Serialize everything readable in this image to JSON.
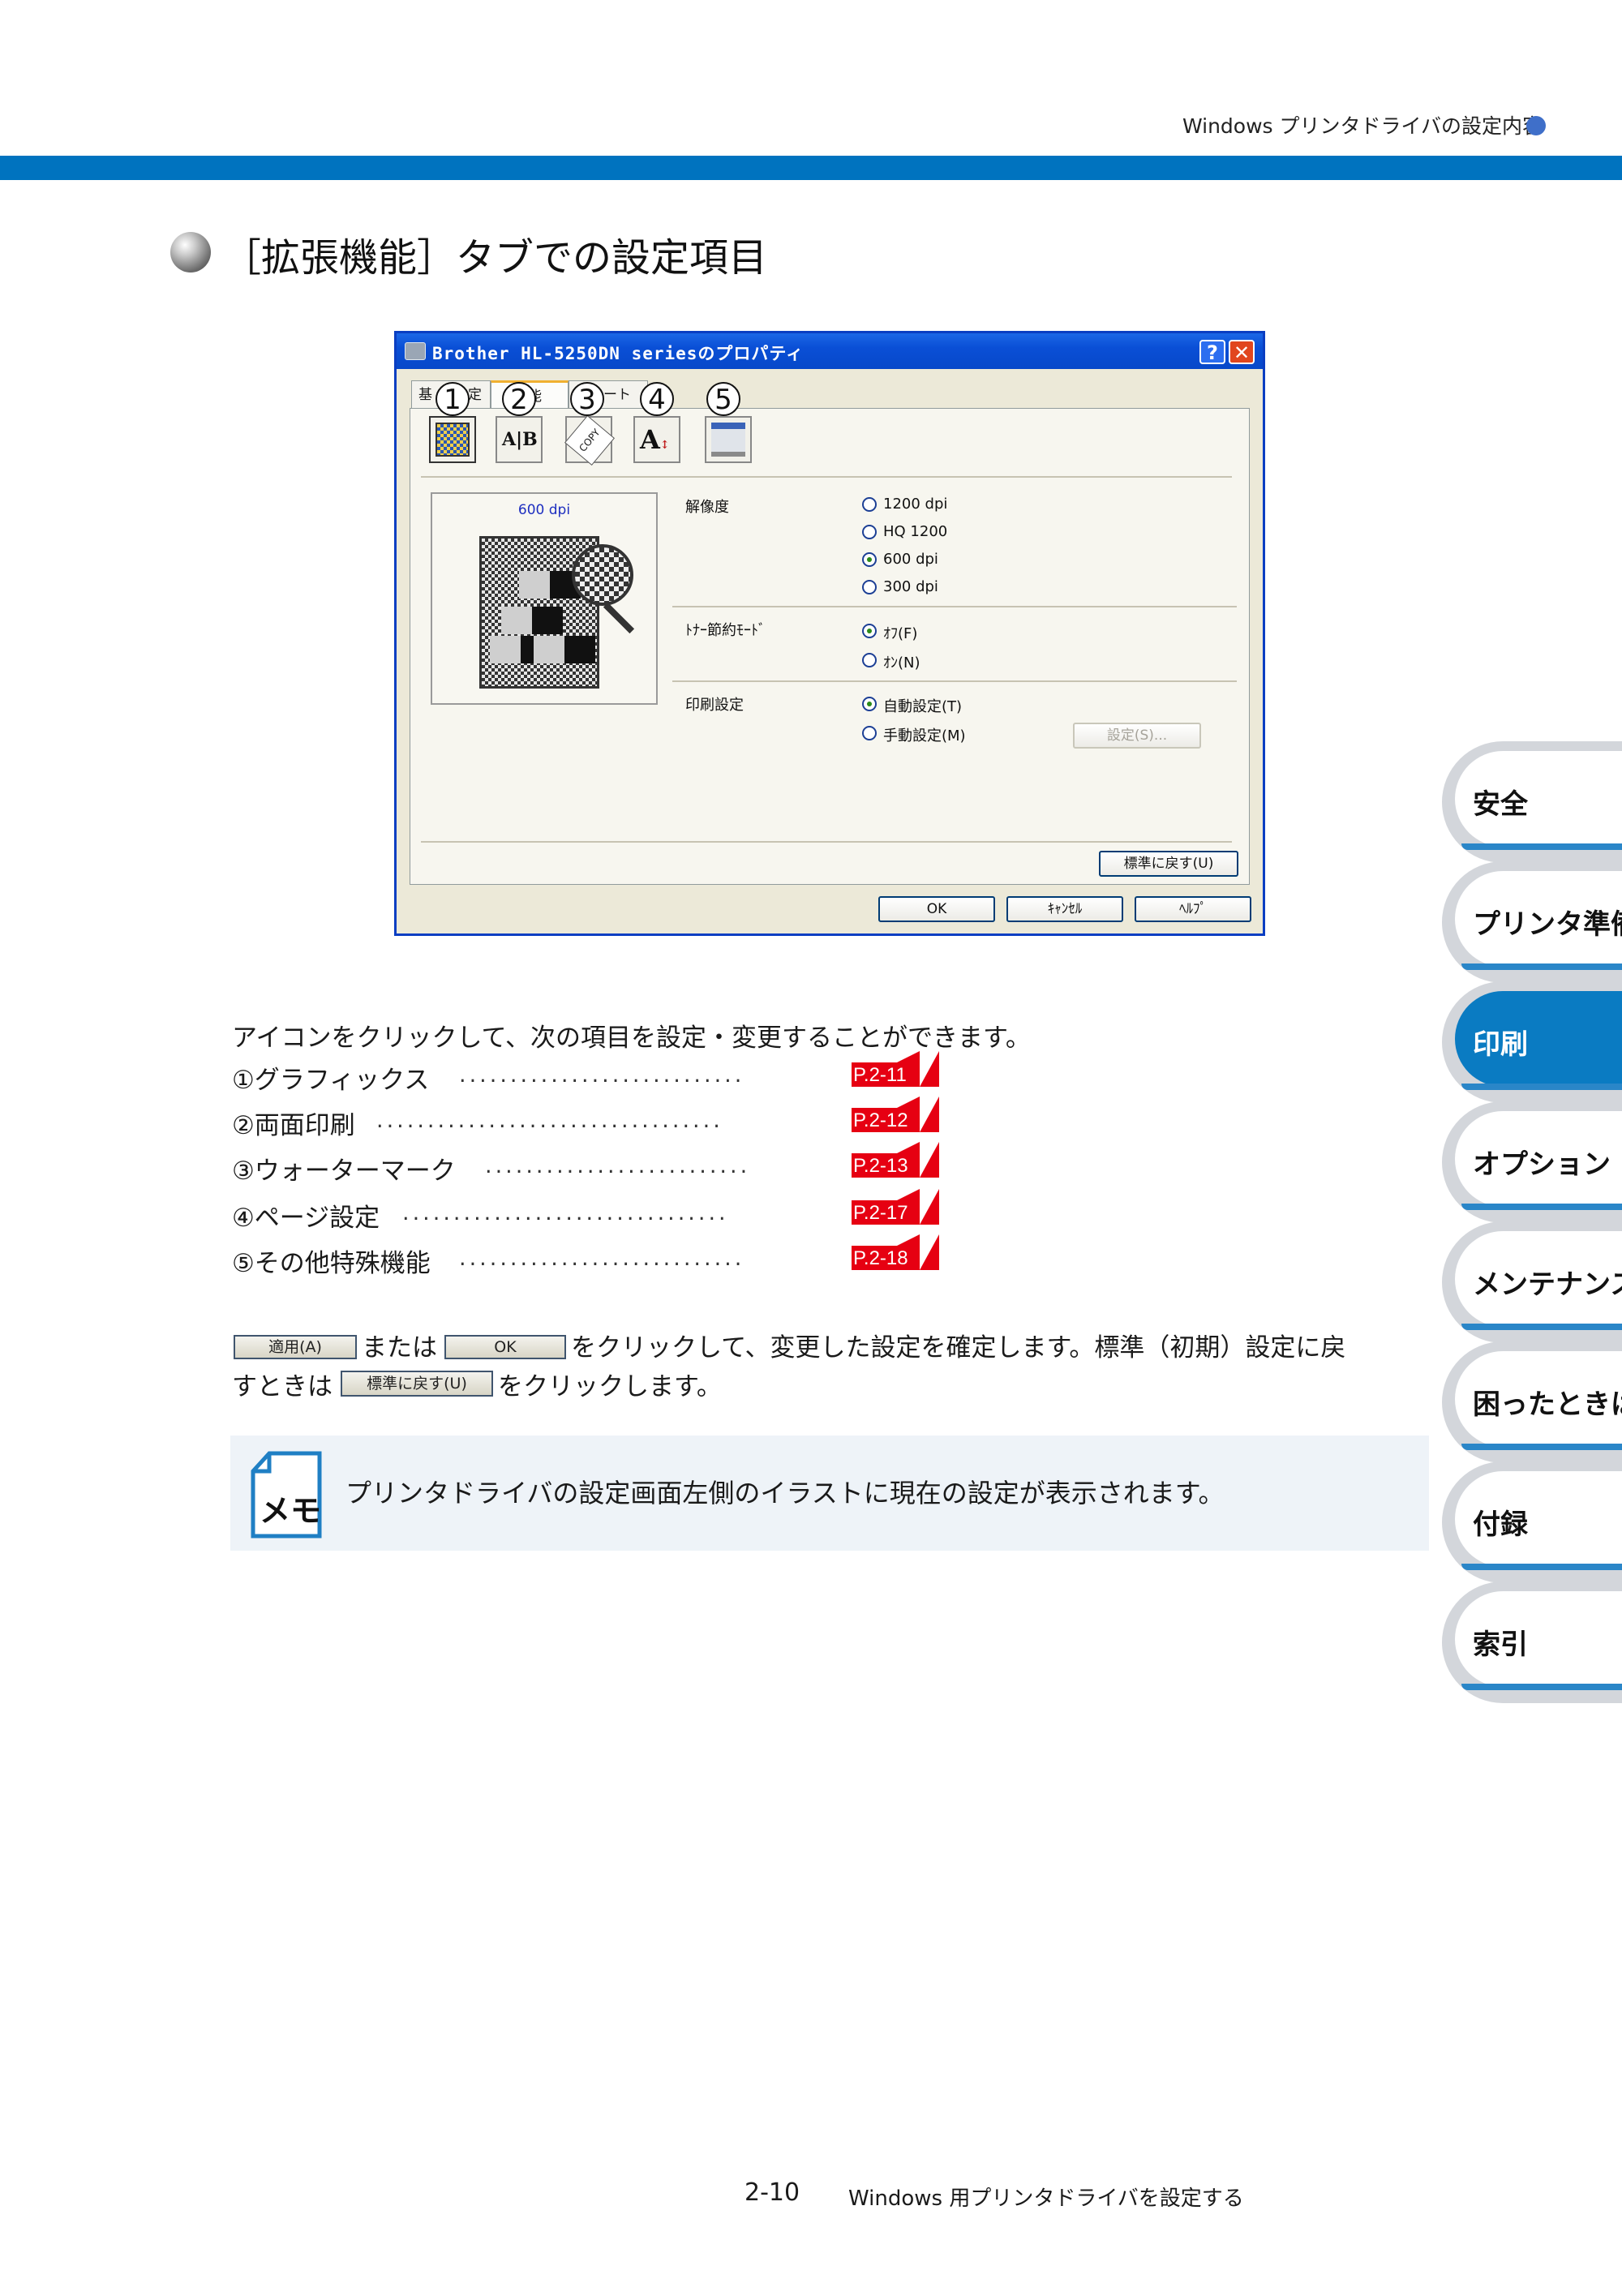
{
  "header": {
    "title": "Windows プリンタドライバの設定内容"
  },
  "section": {
    "title": "［拡張機能］タブでの設定項目"
  },
  "dialog": {
    "title": "Brother HL-5250DN seriesのプロパティ",
    "help_btn": "?",
    "close_btn": "✕",
    "tabs": [
      "基本設定",
      "拡張機能",
      "サポート"
    ],
    "tab_fragments": [
      "基",
      "定",
      "機能",
      "ート"
    ],
    "icon_numbers": [
      "1",
      "2",
      "3",
      "4",
      "5"
    ],
    "icon_names": [
      "graphics-icon",
      "duplex-icon",
      "watermark-icon",
      "page-setting-icon",
      "other-functions-icon"
    ],
    "preview_dpi": "600 dpi",
    "resolution_label": "解像度",
    "resolution_options": [
      "1200 dpi",
      "HQ 1200",
      "600 dpi",
      "300 dpi"
    ],
    "resolution_selected": "600 dpi",
    "toner_label": "ﾄﾅｰ節約ﾓｰﾄﾞ",
    "toner_options": [
      "ｵﾌ(F)",
      "ｵﾝ(N)"
    ],
    "print_setting_label": "印刷設定",
    "print_setting_options": [
      "自動設定(T)",
      "手動設定(M)"
    ],
    "settings_btn": "設定(S)...",
    "default_btn": "標準に戻す(U)",
    "ok_btn": "OK",
    "cancel_btn": "ｷｬﾝｾﾙ",
    "help_text_btn": "ﾍﾙﾌﾟ"
  },
  "body": {
    "intro": "アイコンをクリックして、次の項目を設定・変更することができます。",
    "items": [
      {
        "label": "①グラフィックス",
        "dots": "............................",
        "ref": "P.2-11"
      },
      {
        "label": "②両面印刷",
        "dots": "..................................",
        "ref": "P.2-12"
      },
      {
        "label": "③ウォーターマーク",
        "dots": "..........................",
        "ref": "P.2-13"
      },
      {
        "label": "④ページ設定",
        "dots": "................................",
        "ref": "P.2-17"
      },
      {
        "label": "⑤その他特殊機能",
        "dots": "............................",
        "ref": "P.2-18"
      }
    ],
    "apply_btn": "適用(A)",
    "or_text": "または",
    "ok_btn": "OK",
    "line1_rest": "をクリックして、変更した設定を確定します。標準（初期）設定に戻",
    "line2_start": "すときは",
    "default_btn": "標準に戻す(U)",
    "line2_rest": "をクリックします。"
  },
  "memo": {
    "icon_label": "メモ",
    "text": "プリンタドライバの設定画面左側のイラストに現在の設定が表示されます。"
  },
  "side_tabs": [
    "安全",
    "プリンタ準備",
    "印刷",
    "オプション",
    "メンテナンス",
    "困ったときは",
    "付録",
    "索引"
  ],
  "side_active": "印刷",
  "footer": {
    "page": "2-10",
    "title": "Windows 用プリンタドライバを設定する"
  },
  "colors": {
    "accent": "#0073bf",
    "ref_red": "#e60012",
    "memo_bg": "#eef3f8"
  }
}
